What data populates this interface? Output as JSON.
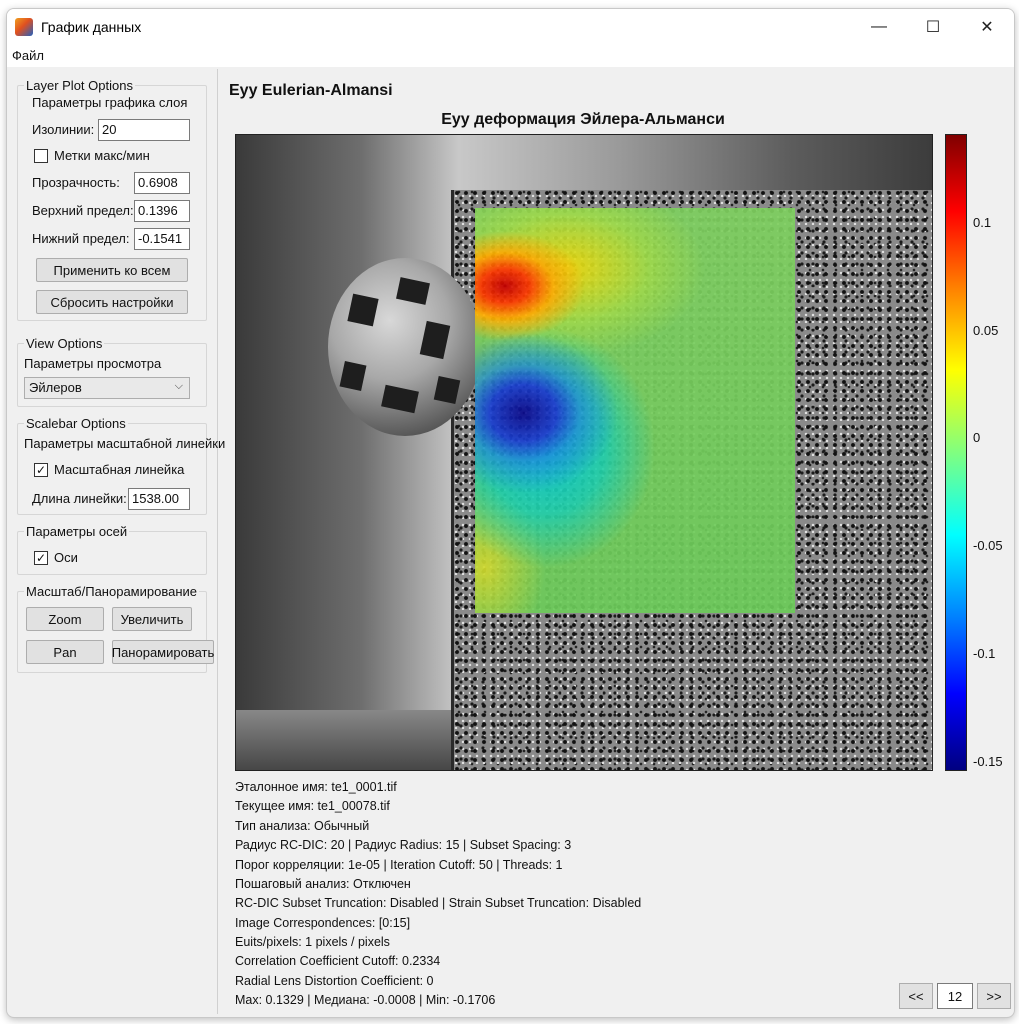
{
  "window": {
    "title": "График данных",
    "controls": {
      "minimize": "—",
      "maximize": "☐",
      "close": "✕"
    }
  },
  "menu": {
    "file": "Файл"
  },
  "layer_plot": {
    "group_title": "Layer Plot Options",
    "subtitle": "Параметры графика слоя",
    "isolines_label": "Изолинии:",
    "isolines_value": "20",
    "minmax_label": "Метки макс/мин",
    "minmax_checked": false,
    "transparency_label": "Прозрачность:",
    "transparency_value": "0.6908",
    "upper_label": "Верхний предел:",
    "upper_value": "0.1396",
    "lower_label": "Нижний предел:",
    "lower_value": "-0.1541",
    "apply_all": "Применить ко всем",
    "reset": "Сбросить настройки"
  },
  "view": {
    "group_title": "View Options",
    "subtitle": "Параметры просмотра",
    "selected": "Эйлеров"
  },
  "scalebar": {
    "group_title": "Scalebar Options",
    "subtitle": "Параметры масштабной линейки",
    "checkbox_label": "Масштабная линейка",
    "checkbox_checked": true,
    "length_label": "Длина линейки:",
    "length_value": "1538.00"
  },
  "axes": {
    "group_title": "Параметры осей",
    "checkbox_label": "Оси",
    "checkbox_checked": true
  },
  "zoompan": {
    "group_title": "Масштаб/Панорамирование",
    "zoom": "Zoom",
    "zoom_ru": "Увеличить",
    "pan": "Pan",
    "pan_ru": "Панорамировать"
  },
  "plot": {
    "panel_title": "Eyy Eulerian-Almansi",
    "title": "Eyy деформация Эйлера-Альманси",
    "colorbar_ticks": [
      "0.1",
      "0.05",
      "0",
      "-0.05",
      "-0.1",
      "-0.15"
    ]
  },
  "info": [
    "Эталонное имя: te1_0001.tif",
    "Текущее имя: te1_00078.tif",
    "Тип анализа: Обычный",
    "Радиус RC-DIC: 20 | Радиус Radius: 15 | Subset Spacing: 3",
    "Порог корреляции: 1e-05 | Iteration Cutoff: 50 | Threads: 1",
    "Пошаговый анализ: Отключен",
    "RC-DIC Subset Truncation: Disabled | Strain Subset Truncation: Disabled",
    "Image Correspondences: [0:15]",
    "Euits/pixels: 1 pixels / pixels",
    "Correlation Coefficient Cutoff: 0.2334",
    "Radial Lens Distortion Coefficient: 0",
    "Max: 0.1329 | Медиана: -0.0008 | Min: -0.1706"
  ],
  "nav": {
    "prev": "<<",
    "frame": "12",
    "next": ">>"
  }
}
